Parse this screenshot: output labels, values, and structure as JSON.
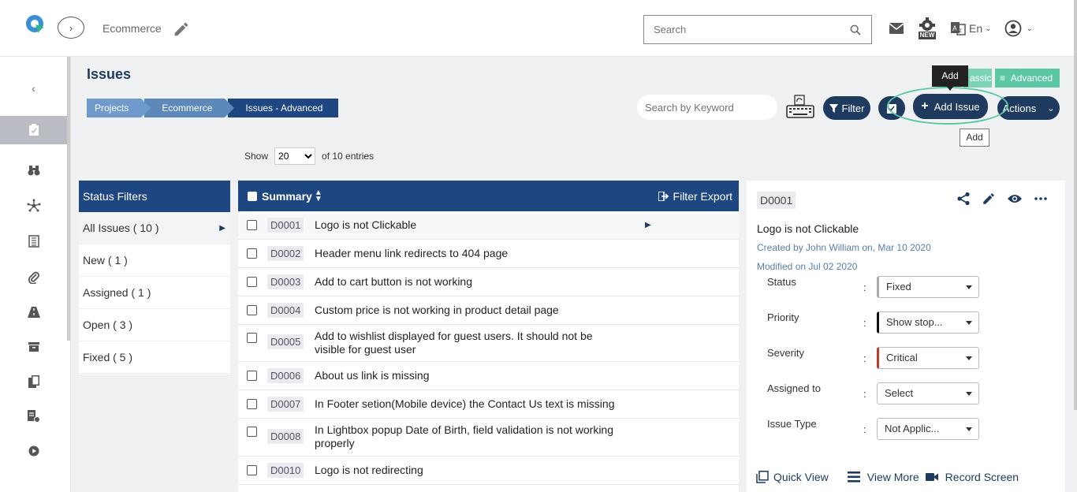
{
  "header": {
    "project_name": "Ecommerce",
    "search_placeholder": "Search",
    "language": "En",
    "new_badge": "NEW"
  },
  "page": {
    "title": "Issues",
    "breadcrumb": [
      "Projects",
      "Ecommerce",
      "Issues - Advanced"
    ],
    "view_classic": "assic",
    "view_advanced": "Advanced"
  },
  "toolbar": {
    "keyword_placeholder": "Search by Keyword",
    "filter_label": "Filter",
    "add_label": "Add Issue",
    "actions_label": "Actions",
    "tooltip_dark": "Add",
    "tooltip_light": "Add"
  },
  "entries": {
    "show_label": "Show",
    "page_size": "20",
    "of_label": "of 10 entries"
  },
  "status_filters": {
    "heading": "Status Filters",
    "items": [
      "All Issues ( 10 )",
      "New ( 1 )",
      "Assigned ( 1 )",
      "Open ( 3 )",
      "Fixed ( 5 )"
    ]
  },
  "table": {
    "summary_header": "Summary",
    "export_label": "Filter Export",
    "rows": [
      {
        "id": "D0001",
        "summary": "Logo is not Clickable"
      },
      {
        "id": "D0002",
        "summary": "Header menu link redirects to 404 page"
      },
      {
        "id": "D0003",
        "summary": "Add to cart button is not working"
      },
      {
        "id": "D0004",
        "summary": "Custom price is not working in product detail page"
      },
      {
        "id": "D0005",
        "summary": "Add to wishlist displayed for guest users. It should not be visible for guest user"
      },
      {
        "id": "D0006",
        "summary": "About us link is missing"
      },
      {
        "id": "D0007",
        "summary": "In Footer setion(Mobile device) the Contact Us text is missing"
      },
      {
        "id": "D0008",
        "summary": "In Lightbox popup Date of Birth, field validation is not working properly"
      },
      {
        "id": "D0010",
        "summary": "Logo is not redirecting"
      }
    ]
  },
  "detail": {
    "id": "D0001",
    "title": "Logo is not Clickable",
    "created": "Created by John William on, Mar 10 2020",
    "modified": "Modified on Jul 02 2020",
    "fields": [
      {
        "label": "Status",
        "value": "Fixed"
      },
      {
        "label": "Priority",
        "value": "Show stop..."
      },
      {
        "label": "Severity",
        "value": "Critical"
      },
      {
        "label": "Assigned to",
        "value": "Select"
      },
      {
        "label": "Issue Type",
        "value": "Not Applic..."
      }
    ],
    "quick_view": "Quick View",
    "view_more": "View More",
    "record_screen": "Record Screen"
  },
  "colors": {
    "navy": "#1e3a5f",
    "table_header": "#1e4680",
    "accent_green": "#5cc7a4",
    "critical_red": "#c0392b"
  }
}
